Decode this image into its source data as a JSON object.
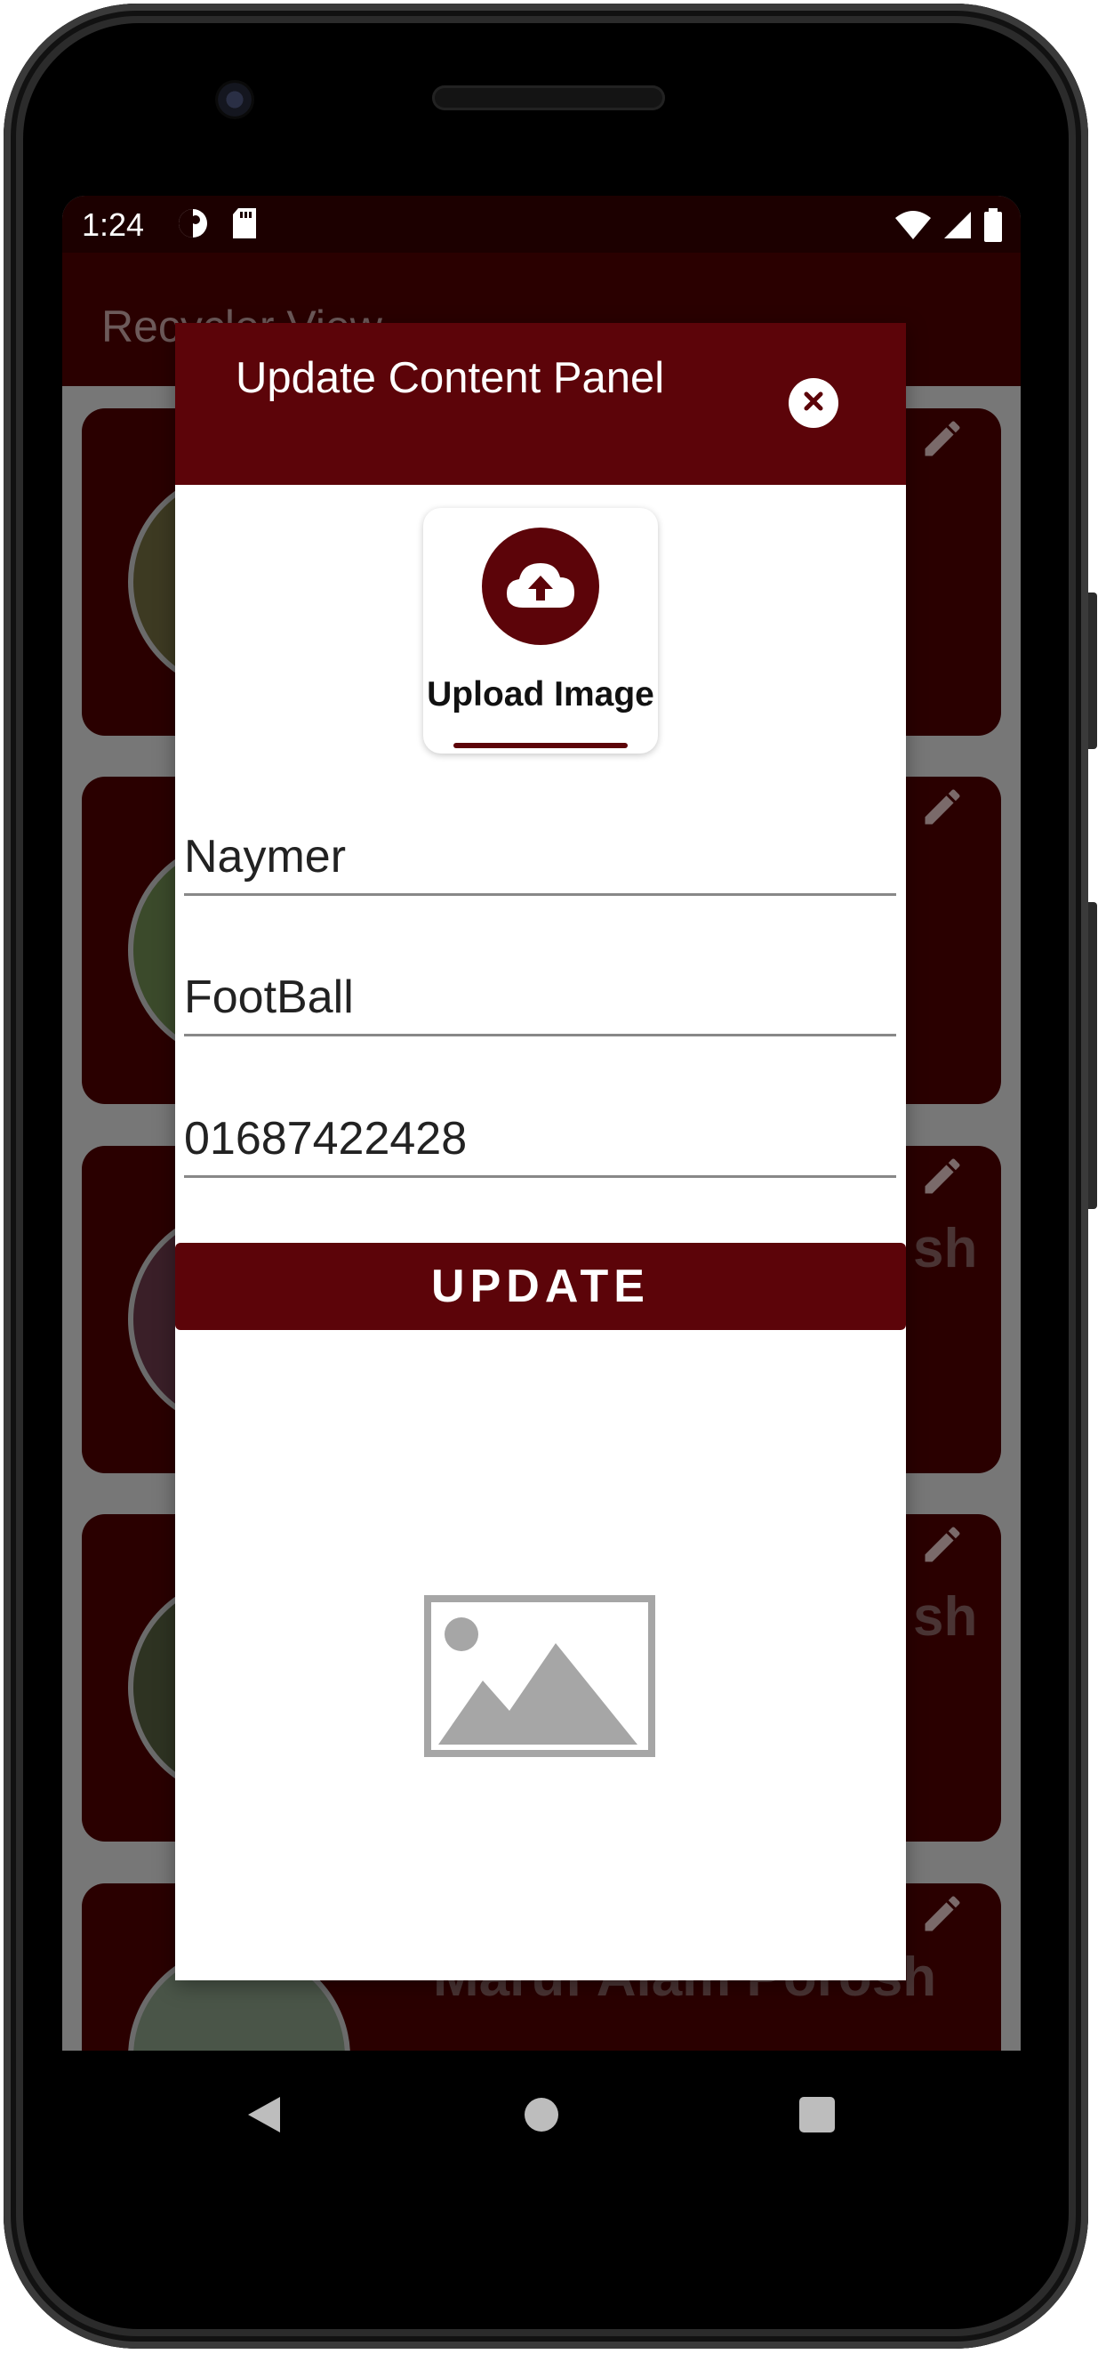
{
  "status_bar": {
    "time": "1:24"
  },
  "app_bar": {
    "title": "Recycler View"
  },
  "list": {
    "cards": [
      {
        "name": ""
      },
      {
        "name": ""
      },
      {
        "name": "sh"
      },
      {
        "name": "sh"
      },
      {
        "name": "Maruf Alam Porosh"
      }
    ]
  },
  "dialog": {
    "title": "Update Content Panel",
    "upload_label": "Upload Image",
    "fields": {
      "name_value": "Naymer",
      "category_value": "FootBall",
      "phone_value": "01687422428"
    },
    "update_label": "UPDATE"
  },
  "colors": {
    "primary": "#5c0409",
    "app_bar": "#2a0000",
    "status_bar": "#1c0000"
  },
  "icons": {
    "close": "close-icon",
    "upload": "cloud-upload-icon",
    "placeholder": "image-placeholder-icon",
    "edit": "pencil-icon"
  }
}
